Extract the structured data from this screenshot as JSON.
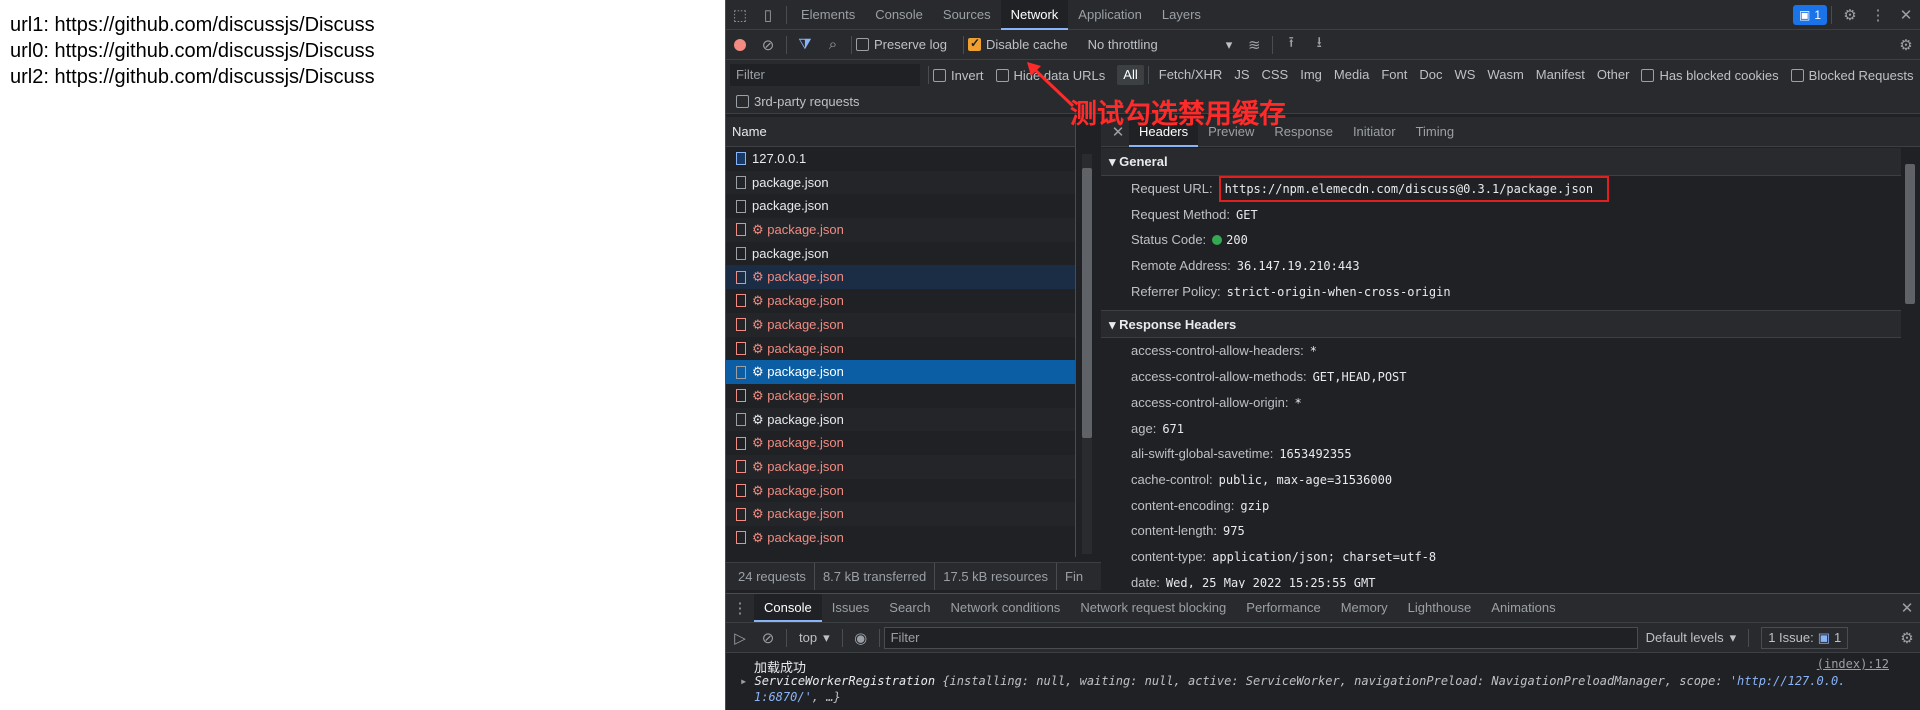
{
  "page": {
    "lines": [
      "url1: https://github.com/discussjs/Discuss",
      "url0: https://github.com/discussjs/Discuss",
      "url2: https://github.com/discussjs/Discuss"
    ]
  },
  "devtools": {
    "tabs": [
      "Elements",
      "Console",
      "Sources",
      "Network",
      "Application",
      "Layers"
    ],
    "active_tab": "Network",
    "message_count": "1",
    "toolbar": {
      "preserve_log": "Preserve log",
      "disable_cache": "Disable cache",
      "throttling": "No throttling"
    },
    "filter": {
      "placeholder": "Filter",
      "invert": "Invert",
      "hide_data_urls": "Hide data URLs",
      "types": [
        "All",
        "Fetch/XHR",
        "JS",
        "CSS",
        "Img",
        "Media",
        "Font",
        "Doc",
        "WS",
        "Wasm",
        "Manifest",
        "Other"
      ],
      "blocked_cookies": "Has blocked cookies",
      "blocked_requests": "Blocked Requests",
      "third_party": "3rd-party requests"
    },
    "annotation": "测试勾选禁用缓存",
    "list": {
      "header": "Name",
      "rows": [
        {
          "name": "127.0.0.1",
          "kind": "doc"
        },
        {
          "name": "package.json",
          "kind": "normal"
        },
        {
          "name": "package.json",
          "kind": "normal"
        },
        {
          "name": "⚙ package.json",
          "kind": "err"
        },
        {
          "name": "package.json",
          "kind": "normal"
        },
        {
          "name": "⚙ package.json",
          "kind": "err-hl"
        },
        {
          "name": "⚙ package.json",
          "kind": "err"
        },
        {
          "name": "⚙ package.json",
          "kind": "err"
        },
        {
          "name": "⚙ package.json",
          "kind": "err"
        },
        {
          "name": "⚙ package.json",
          "kind": "sel"
        },
        {
          "name": "⚙ package.json",
          "kind": "err"
        },
        {
          "name": "⚙ package.json",
          "kind": "normal"
        },
        {
          "name": "⚙ package.json",
          "kind": "err"
        },
        {
          "name": "⚙ package.json",
          "kind": "err"
        },
        {
          "name": "⚙ package.json",
          "kind": "err"
        },
        {
          "name": "⚙ package.json",
          "kind": "err"
        },
        {
          "name": "⚙ package.json",
          "kind": "err"
        }
      ]
    },
    "status": {
      "requests": "24 requests",
      "transferred": "8.7 kB transferred",
      "resources": "17.5 kB resources",
      "finish": "Fin"
    },
    "detail_tabs": [
      "Headers",
      "Preview",
      "Response",
      "Initiator",
      "Timing"
    ],
    "general": {
      "title": "General",
      "request_url_label": "Request URL:",
      "request_url": "https://npm.elemecdn.com/discuss@0.3.1/package.json",
      "method_label": "Request Method:",
      "method": "GET",
      "status_label": "Status Code:",
      "status": "200",
      "remote_label": "Remote Address:",
      "remote": "36.147.19.210:443",
      "referrer_label": "Referrer Policy:",
      "referrer": "strict-origin-when-cross-origin"
    },
    "response_headers": {
      "title": "Response Headers",
      "items": [
        {
          "k": "access-control-allow-headers:",
          "v": "*"
        },
        {
          "k": "access-control-allow-methods:",
          "v": "GET,HEAD,POST"
        },
        {
          "k": "access-control-allow-origin:",
          "v": "*"
        },
        {
          "k": "age:",
          "v": "671"
        },
        {
          "k": "ali-swift-global-savetime:",
          "v": "1653492355"
        },
        {
          "k": "cache-control:",
          "v": "public, max-age=31536000"
        },
        {
          "k": "content-encoding:",
          "v": "gzip"
        },
        {
          "k": "content-length:",
          "v": "975"
        },
        {
          "k": "content-type:",
          "v": "application/json; charset=utf-8"
        },
        {
          "k": "date:",
          "v": "Wed, 25 May 2022 15:25:55 GMT"
        }
      ]
    },
    "drawer_tabs": [
      "Console",
      "Issues",
      "Search",
      "Network conditions",
      "Network request blocking",
      "Performance",
      "Memory",
      "Lighthouse",
      "Animations"
    ],
    "console": {
      "context": "top",
      "filter_placeholder": "Filter",
      "levels": "Default levels",
      "issues": "1 Issue:",
      "issues_count": "1",
      "log_text": "加载成功",
      "log_source": "(index):12",
      "obj_class": "ServiceWorkerRegistration",
      "obj_body_1": "{installing: null, waiting: null, active: ServiceWorker, navigationPreload: NavigationPreloadManager, scope: ",
      "obj_scope": "'http://127.0.0.",
      "obj_body_2": "1:6870/'",
      "obj_tail": ", …}"
    }
  }
}
